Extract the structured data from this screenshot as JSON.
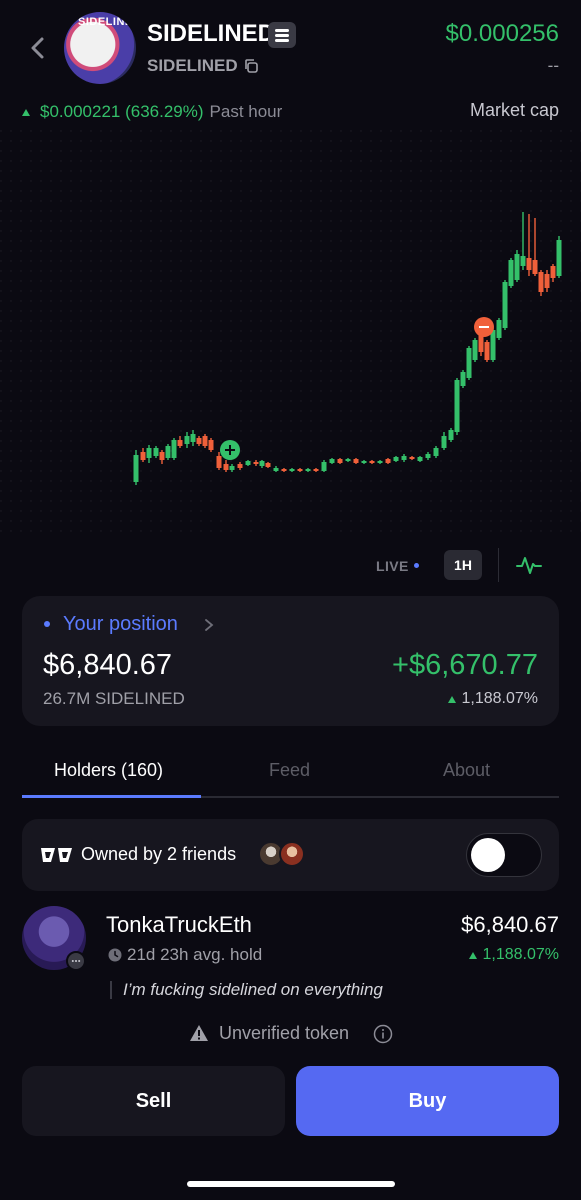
{
  "header": {
    "token_name": "SIDELINED",
    "token_symbol": "SIDELINED",
    "avatar_text": "SIDELINED",
    "price": "$0.000256",
    "price_sub": "--",
    "change_value": "$0.000221 (636.29%)",
    "change_period": "Past hour",
    "market_cap_label": "Market cap"
  },
  "chart_controls": {
    "live_label": "LIVE",
    "timeframe": "1H"
  },
  "position": {
    "title": "Your position",
    "value": "$6,840.67",
    "gain": "+$6,670.77",
    "amount": "26.7M SIDELINED",
    "percent": "1,188.07%"
  },
  "tabs": [
    {
      "label": "Holders (160)",
      "active": true
    },
    {
      "label": "Feed",
      "active": false
    },
    {
      "label": "About",
      "active": false
    }
  ],
  "friends": {
    "label": "Owned by 2 friends",
    "toggle_on": false
  },
  "holder": {
    "name": "TonkaTruckEth",
    "hold_time": "21d 23h avg. hold",
    "value": "$6,840.67",
    "percent": "1,188.07%",
    "quote": "I’m fucking sidelined on everything"
  },
  "warning": {
    "label": "Unverified token"
  },
  "actions": {
    "sell_label": "Sell",
    "buy_label": "Buy"
  },
  "colors": {
    "up": "#34c06a",
    "down": "#f0603a",
    "accent": "#5b7bff",
    "buy": "#5569f2"
  },
  "icons": [
    "back-chevron-icon",
    "token-badge-icon",
    "copy-icon",
    "pulse-icon",
    "chevron-right-icon",
    "friends-logo-icon",
    "clock-icon",
    "chat-icon",
    "warning-icon",
    "info-icon"
  ]
}
